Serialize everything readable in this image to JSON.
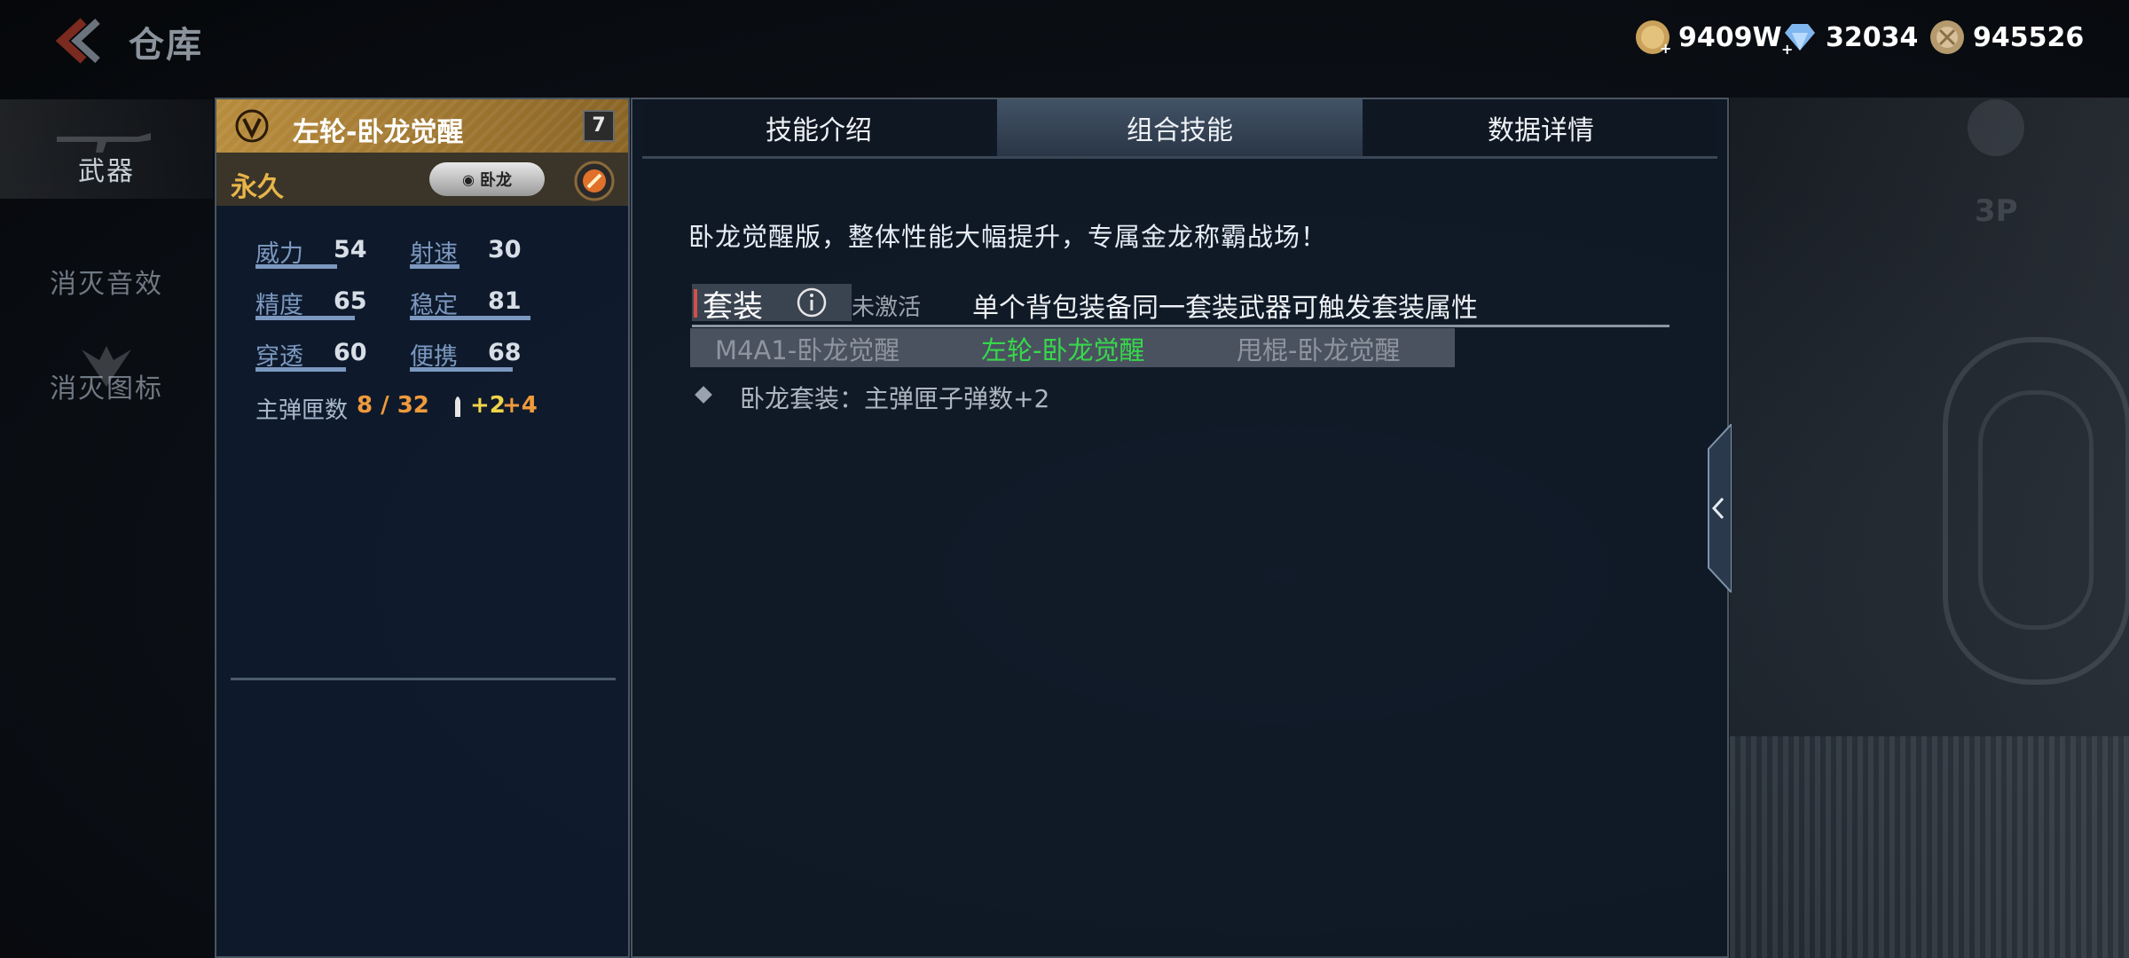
{
  "header": {
    "title": "仓库",
    "currencies": [
      {
        "icon": "gold-coin-icon",
        "value": "9409W"
      },
      {
        "icon": "diamond-icon",
        "value": "32034"
      },
      {
        "icon": "medal-coin-icon",
        "value": "945526"
      }
    ]
  },
  "nav": {
    "items": [
      {
        "label": "武器",
        "active": true
      },
      {
        "label": "消灭音效",
        "active": false
      },
      {
        "label": "消灭图标",
        "active": false
      }
    ]
  },
  "weapon": {
    "name": "左轮-卧龙觉醒",
    "level": "7",
    "duration": "永久",
    "tag": "卧龙",
    "stats": [
      {
        "label": "威力",
        "value": "54"
      },
      {
        "label": "射速",
        "value": "30"
      },
      {
        "label": "精度",
        "value": "65"
      },
      {
        "label": "稳定",
        "value": "81"
      },
      {
        "label": "穿透",
        "value": "60"
      },
      {
        "label": "便携",
        "value": "68"
      }
    ],
    "ammo_label": "主弹匣数",
    "ammo_value": "8 / 32",
    "ammo_bonus_a": "+2",
    "ammo_bonus_b": "+4"
  },
  "tabs": [
    {
      "label": "技能介绍",
      "active": false
    },
    {
      "label": "组合技能",
      "active": true
    },
    {
      "label": "数据详情",
      "active": false
    }
  ],
  "combo": {
    "description": "卧龙觉醒版，整体性能大幅提升，专属金龙称霸战场！",
    "set_title": "套装",
    "set_status": "未激活",
    "set_desc": "单个背包装备同一套装武器可触发套装属性",
    "members": [
      {
        "name": "M4A1-卧龙觉醒",
        "color": "#8e959e"
      },
      {
        "name": "左轮-卧龙觉醒",
        "color": "#37d84a"
      },
      {
        "name": "甩棍-卧龙觉醒",
        "color": "#8e959e"
      }
    ],
    "effect": "卧龙套装：主弹匣子弹数+2"
  },
  "colors": {
    "accent_gold": "#e8b54a",
    "active_member": "#37d84a",
    "ammo_orange": "#f09a3c"
  }
}
